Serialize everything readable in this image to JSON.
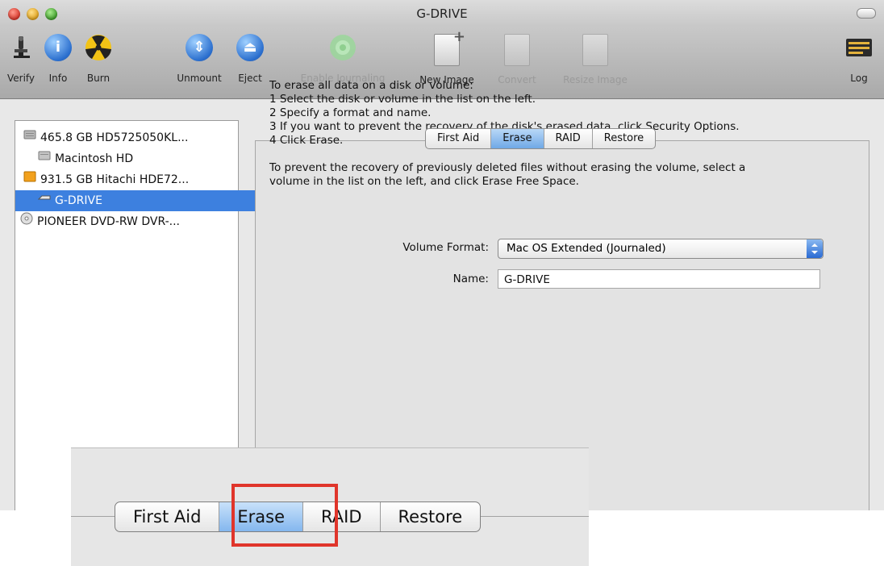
{
  "window": {
    "title": "G-DRIVE"
  },
  "toolbar": {
    "items": [
      {
        "label": "Verify",
        "icon": "microscope-icon",
        "enabled": true
      },
      {
        "label": "Info",
        "icon": "info-icon",
        "enabled": true
      },
      {
        "label": "Burn",
        "icon": "burn-icon",
        "enabled": true
      },
      {
        "label": "Unmount",
        "icon": "unmount-icon",
        "enabled": true
      },
      {
        "label": "Eject",
        "icon": "eject-icon",
        "enabled": true
      },
      {
        "label": "Enable Journaling",
        "icon": "journaling-icon",
        "enabled": false
      },
      {
        "label": "New Image",
        "icon": "new-image-icon",
        "enabled": true
      },
      {
        "label": "Convert",
        "icon": "convert-icon",
        "enabled": false
      },
      {
        "label": "Resize Image",
        "icon": "resize-image-icon",
        "enabled": false
      }
    ],
    "log_label": "Log"
  },
  "sidebar": {
    "items": [
      {
        "label": "465.8 GB HD5725050KL...",
        "icon": "disk-icon",
        "selected": false
      },
      {
        "label": "Macintosh HD",
        "icon": "volume-icon",
        "selected": false
      },
      {
        "label": "931.5 GB Hitachi HDE72...",
        "icon": "external-disk-icon",
        "selected": false
      },
      {
        "label": "G-DRIVE",
        "icon": "volume-icon",
        "selected": true
      },
      {
        "label": "PIONEER DVD-RW DVR-...",
        "icon": "optical-drive-icon",
        "selected": false
      }
    ]
  },
  "tabs": [
    {
      "label": "First Aid",
      "selected": false
    },
    {
      "label": "Erase",
      "selected": true
    },
    {
      "label": "RAID",
      "selected": false
    },
    {
      "label": "Restore",
      "selected": false
    }
  ],
  "erase": {
    "intro": "To erase all data on a disk or volume:",
    "steps": [
      "1 Select the disk or volume in the list on the left.",
      "2 Specify a format and name.",
      "3 If you want to prevent the recovery of the disk's erased data, click Security Options.",
      "4 Click Erase."
    ],
    "free_space_line1": "To prevent the recovery of previously deleted files without erasing the volume, select a",
    "free_space_line2": "volume in the list on the left, and click Erase Free Space.",
    "format_label": "Volume Format:",
    "format_value": "Mac OS Extended (Journaled)",
    "name_label": "Name:",
    "name_value": "G-DRIVE"
  },
  "zoom": {
    "tabs": [
      {
        "label": "First Aid",
        "selected": false
      },
      {
        "label": "Erase",
        "selected": true
      },
      {
        "label": "RAID",
        "selected": false
      },
      {
        "label": "Restore",
        "selected": false
      }
    ],
    "highlight_color": "#e0352b"
  }
}
